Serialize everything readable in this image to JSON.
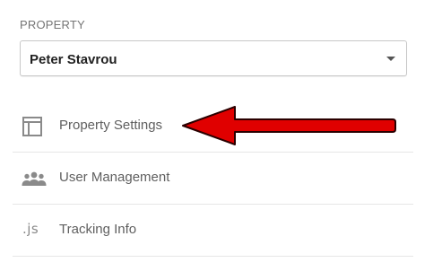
{
  "property": {
    "section_label": "PROPERTY",
    "selected_value": "Peter Stavrou"
  },
  "menu": {
    "items": [
      {
        "label": "Property Settings",
        "icon": "property-settings-icon"
      },
      {
        "label": "User Management",
        "icon": "users-icon"
      },
      {
        "label": "Tracking Info",
        "icon": "js-icon",
        "icon_text": ".js"
      }
    ]
  },
  "annotation": {
    "arrow_color": "#e00000",
    "points_to": "Property Settings"
  },
  "colors": {
    "label_text": "#5f5f5f",
    "icon": "#8a8a8a",
    "divider": "#e6e6e6"
  }
}
